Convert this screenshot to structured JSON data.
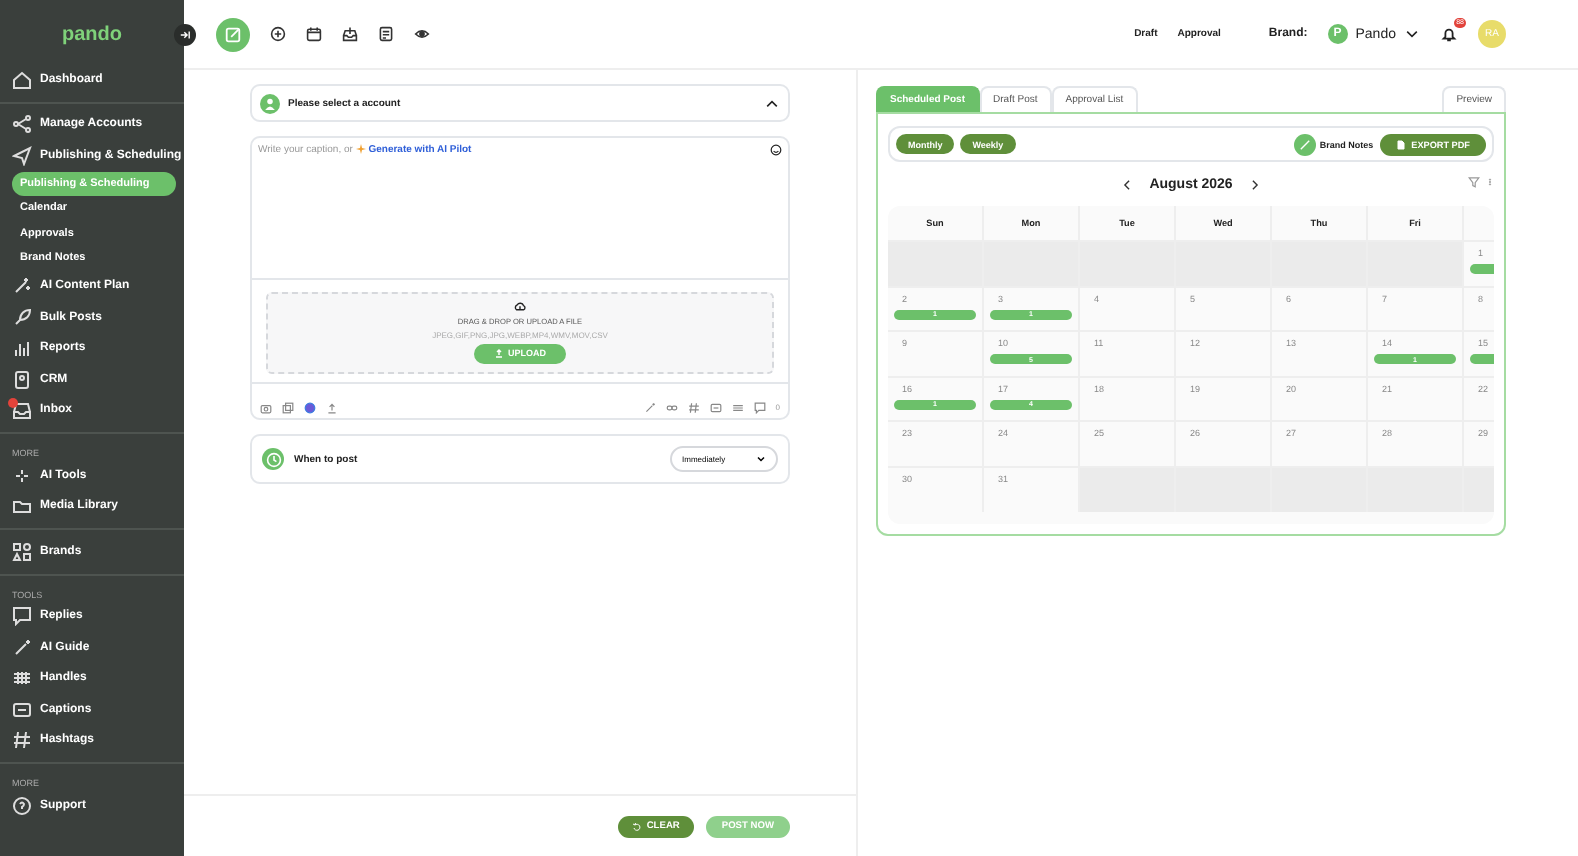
{
  "sidebar": {
    "logo": "pando",
    "items": [
      {
        "kind": "item",
        "label": "Dashboard"
      },
      {
        "kind": "divider"
      },
      {
        "kind": "item",
        "label": "Manage Accounts"
      },
      {
        "kind": "item",
        "label": "Publishing & Scheduling"
      },
      {
        "kind": "subitem",
        "label": "Publishing & Scheduling",
        "selected": true
      },
      {
        "kind": "subitem",
        "label": "Calendar",
        "selected": false
      },
      {
        "kind": "subitem",
        "label": "Approvals",
        "selected": false
      },
      {
        "kind": "subitem",
        "label": "Brand Notes",
        "selected": false
      },
      {
        "kind": "item",
        "label": "AI Content Plan"
      },
      {
        "kind": "item",
        "label": "Bulk Posts"
      },
      {
        "kind": "item",
        "label": "Reports"
      },
      {
        "kind": "item",
        "label": "CRM"
      },
      {
        "kind": "item",
        "label": "Inbox",
        "badge": true
      },
      {
        "kind": "divider"
      },
      {
        "kind": "section",
        "label": "MORE"
      },
      {
        "kind": "item",
        "label": "AI Tools"
      },
      {
        "kind": "item",
        "label": "Media Library"
      },
      {
        "kind": "divider"
      },
      {
        "kind": "item",
        "label": "Brands"
      },
      {
        "kind": "divider"
      },
      {
        "kind": "section",
        "label": "TOOLS"
      },
      {
        "kind": "item",
        "label": "Replies"
      },
      {
        "kind": "item",
        "label": "AI Guide"
      },
      {
        "kind": "item",
        "label": "Handles"
      },
      {
        "kind": "item",
        "label": "Captions"
      },
      {
        "kind": "item",
        "label": "Hashtags"
      },
      {
        "kind": "divider"
      },
      {
        "kind": "section",
        "label": "MORE"
      },
      {
        "kind": "item",
        "label": "Support"
      }
    ]
  },
  "topbar": {
    "links": [
      "Draft",
      "Approval"
    ],
    "brand_label": "Brand:",
    "brand_initial": "P",
    "brand_name": "Pando",
    "notification_count": "88",
    "avatar": "RA"
  },
  "composer": {
    "account_prompt": "Please select a account",
    "caption_placeholder": "Write your caption, or",
    "ai_link": "Generate with AI Pilot",
    "drop_title": "DRAG & DROP OR UPLOAD A FILE",
    "drop_formats": "JPEG,GIF,PNG,JPG,WEBP,MP4,WMV,MOV,CSV",
    "upload_button": "UPLOAD",
    "char_count": "0",
    "when_label": "When to post",
    "when_value": "Immediately"
  },
  "footer": {
    "buttons": [
      {
        "label": "CLEAR",
        "kind": "secondary"
      },
      {
        "label": "POST NOW",
        "kind": "primary"
      }
    ]
  },
  "calendar": {
    "tabs": [
      {
        "label": "Scheduled Post",
        "selected": true
      },
      {
        "label": "Draft Post",
        "selected": false
      },
      {
        "label": "Approval List",
        "selected": false
      }
    ],
    "preview": "Preview",
    "views": [
      {
        "label": "Monthly"
      },
      {
        "label": "Weekly"
      }
    ],
    "brand_notes": "Brand Notes",
    "export": "EXPORT PDF",
    "month": "August 2026",
    "weekdays": [
      "Sun",
      "Mon",
      "Tue",
      "Wed",
      "Thu",
      "Fri"
    ],
    "weeks": [
      [
        {
          "in_month": false
        },
        {
          "in_month": false
        },
        {
          "in_month": false
        },
        {
          "in_month": false
        },
        {
          "in_month": false
        },
        {
          "in_month": false
        },
        {
          "day": "1",
          "in_month": true,
          "posts": true
        }
      ],
      [
        {
          "day": "2",
          "in_month": true,
          "posts": true,
          "count": "1"
        },
        {
          "day": "3",
          "in_month": true,
          "posts": true,
          "count": "1"
        },
        {
          "day": "4",
          "in_month": true
        },
        {
          "day": "5",
          "in_month": true
        },
        {
          "day": "6",
          "in_month": true
        },
        {
          "day": "7",
          "in_month": true
        },
        {
          "day": "8",
          "in_month": true
        }
      ],
      [
        {
          "day": "9",
          "in_month": true
        },
        {
          "day": "10",
          "in_month": true,
          "posts": true,
          "count": "5"
        },
        {
          "day": "11",
          "in_month": true
        },
        {
          "day": "12",
          "in_month": true
        },
        {
          "day": "13",
          "in_month": true
        },
        {
          "day": "14",
          "in_month": true,
          "posts": true,
          "count": "1"
        },
        {
          "day": "15",
          "in_month": true,
          "posts": true
        }
      ],
      [
        {
          "day": "16",
          "in_month": true,
          "posts": true,
          "count": "1"
        },
        {
          "day": "17",
          "in_month": true,
          "posts": true,
          "count": "4"
        },
        {
          "day": "18",
          "in_month": true
        },
        {
          "day": "19",
          "in_month": true
        },
        {
          "day": "20",
          "in_month": true
        },
        {
          "day": "21",
          "in_month": true
        },
        {
          "day": "22",
          "in_month": true
        }
      ],
      [
        {
          "day": "23",
          "in_month": true
        },
        {
          "day": "24",
          "in_month": true
        },
        {
          "day": "25",
          "in_month": true
        },
        {
          "day": "26",
          "in_month": true
        },
        {
          "day": "27",
          "in_month": true
        },
        {
          "day": "28",
          "in_month": true
        },
        {
          "day": "29",
          "in_month": true
        }
      ],
      [
        {
          "day": "30",
          "in_month": true
        },
        {
          "day": "31",
          "in_month": true
        },
        {
          "in_month": false
        },
        {
          "in_month": false
        },
        {
          "in_month": false
        },
        {
          "in_month": false
        },
        {
          "in_month": false
        }
      ]
    ]
  }
}
